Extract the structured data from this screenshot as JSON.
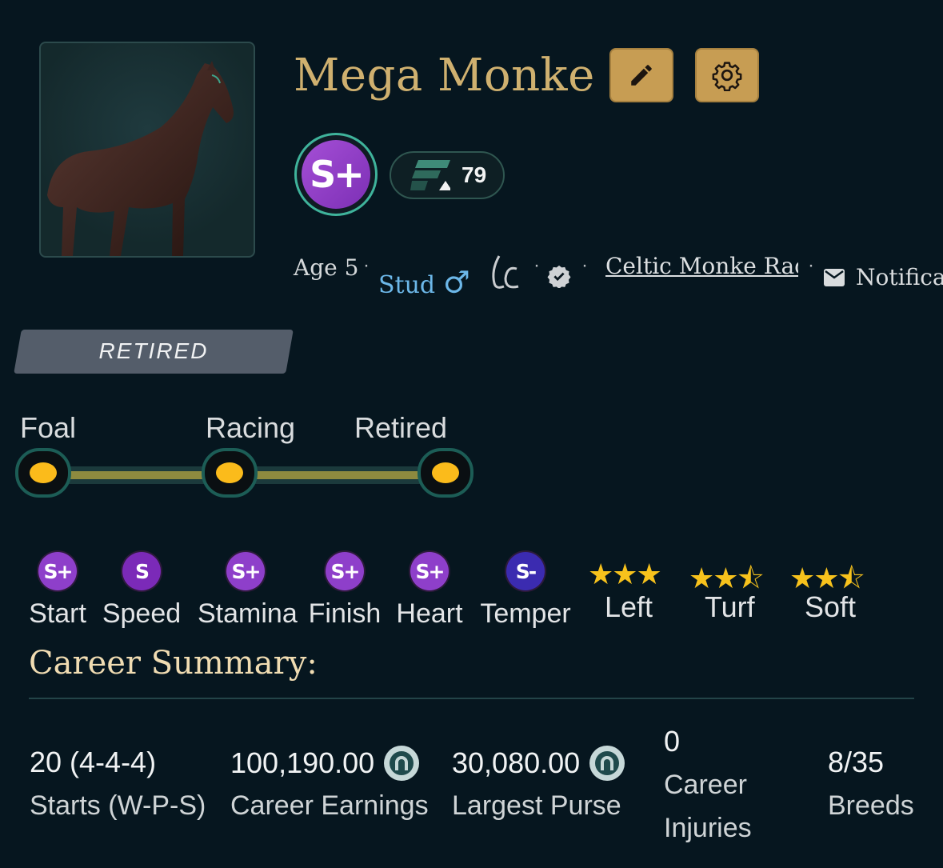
{
  "horse": {
    "name": "Mega Monke",
    "grade": "S+",
    "rating": "79",
    "age": "Age 5",
    "sex": "Stud",
    "sex_symbol": "♂",
    "owner": "Celtic Monke Rac",
    "notifications": "Notifica"
  },
  "status": "RETIRED",
  "lifecycle": {
    "stages": [
      "Foal",
      "Racing",
      "Retired"
    ],
    "progress_percent": 100
  },
  "attributes": [
    {
      "label": "Start",
      "grade": "S+",
      "color": "#8e3fca"
    },
    {
      "label": "Speed",
      "grade": "S",
      "color": "#7b2ab8"
    },
    {
      "label": "Stamina",
      "grade": "S+",
      "color": "#8e3fca"
    },
    {
      "label": "Finish",
      "grade": "S+",
      "color": "#8e3fca"
    },
    {
      "label": "Heart",
      "grade": "S+",
      "color": "#8e3fca"
    },
    {
      "label": "Temper",
      "grade": "S-",
      "color": "#3b2bb0"
    }
  ],
  "preferences": [
    {
      "label": "Left",
      "stars": 3
    },
    {
      "label": "Turf",
      "stars": 2.5
    },
    {
      "label": "Soft",
      "stars": 2.5
    }
  ],
  "career": {
    "title": "Career Summary:",
    "starts_value": "20 (4-4-4)",
    "starts_label": "Starts (W-P-S)",
    "earnings_value": "100,190.00",
    "earnings_label": "Career Earnings",
    "largest_purse_value": "30,080.00",
    "largest_purse_label": "Largest Purse",
    "injuries_value": "0",
    "injuries_label_1": "Career",
    "injuries_label_2": "Injuries",
    "breeds_value": "8/35",
    "breeds_label": "Breeds"
  },
  "icons": {
    "edit": "pencil-icon",
    "settings": "gear-icon",
    "verified": "verified-badge-icon",
    "mail": "envelope-icon",
    "currency": "horseshoe-coin-icon"
  },
  "colors": {
    "background": "#06161f",
    "gold": "#cfb06f",
    "accent_button": "#c79d53",
    "link": "#6cb7e8",
    "star": "#f7c21c",
    "timeline_node": "#fbbb1b"
  }
}
